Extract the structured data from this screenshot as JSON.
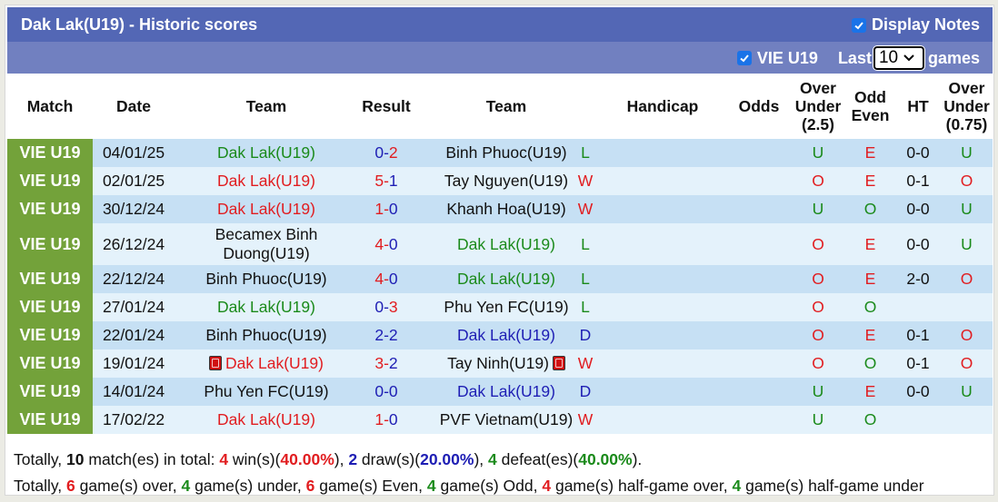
{
  "header": {
    "title": "Dak Lak(U19) - Historic scores",
    "display_notes_label": "Display Notes",
    "display_notes_checked": true
  },
  "filter": {
    "league_label": "VIE U19",
    "league_checked": true,
    "last_label": "Last",
    "games_count": "10",
    "games_label": "games"
  },
  "columns": [
    "Match",
    "Date",
    "Team",
    "Result",
    "Team",
    "Handicap",
    "Odds",
    "Over Under (2.5)",
    "Odd Even",
    "HT",
    "Over Under (0.75)"
  ],
  "columns_multiline": {
    "ou25": [
      "Over",
      "Under",
      "(2.5)"
    ],
    "oddeven": [
      "Odd",
      "Even"
    ],
    "ou075": [
      "Over",
      "Under",
      "(0.75)"
    ]
  },
  "colors": {
    "title_bg": "#5367b5",
    "filter_bg": "#7180c0",
    "match_bg": "#73a23a",
    "row_odd": "#c6e0f4",
    "row_even": "#e4f2fb",
    "red": "#e11d20",
    "blue": "#1e1eb4",
    "green": "#1a8a1a"
  },
  "rows": [
    {
      "match": "VIE U19",
      "date": "04/01/25",
      "home": "Dak Lak(U19)",
      "home_color": "green",
      "home_red_card": false,
      "score_home": "0",
      "score_home_color": "blue",
      "score_away": "2",
      "score_away_color": "red",
      "away": "Binh Phuoc(U19)",
      "away_color": "black",
      "away_red_card": false,
      "wl": "L",
      "wl_color": "green",
      "handicap": "",
      "odds": "",
      "ou25": "U",
      "ou25_color": "green",
      "oe": "E",
      "oe_color": "red",
      "ht": "0-0",
      "ou075": "U",
      "ou075_color": "green"
    },
    {
      "match": "VIE U19",
      "date": "02/01/25",
      "home": "Dak Lak(U19)",
      "home_color": "red",
      "home_red_card": false,
      "score_home": "5",
      "score_home_color": "red",
      "score_away": "1",
      "score_away_color": "blue",
      "away": "Tay Nguyen(U19)",
      "away_color": "black",
      "away_red_card": false,
      "wl": "W",
      "wl_color": "red",
      "handicap": "",
      "odds": "",
      "ou25": "O",
      "ou25_color": "red",
      "oe": "E",
      "oe_color": "red",
      "ht": "0-1",
      "ou075": "O",
      "ou075_color": "red"
    },
    {
      "match": "VIE U19",
      "date": "30/12/24",
      "home": "Dak Lak(U19)",
      "home_color": "red",
      "home_red_card": false,
      "score_home": "1",
      "score_home_color": "red",
      "score_away": "0",
      "score_away_color": "blue",
      "away": "Khanh Hoa(U19)",
      "away_color": "black",
      "away_red_card": false,
      "wl": "W",
      "wl_color": "red",
      "handicap": "",
      "odds": "",
      "ou25": "U",
      "ou25_color": "green",
      "oe": "O",
      "oe_color": "green",
      "ht": "0-0",
      "ou075": "U",
      "ou075_color": "green"
    },
    {
      "match": "VIE U19",
      "date": "26/12/24",
      "home": "Becamex Binh Duong(U19)",
      "home_color": "black",
      "home_red_card": false,
      "score_home": "4",
      "score_home_color": "red",
      "score_away": "0",
      "score_away_color": "blue",
      "away": "Dak Lak(U19)",
      "away_color": "green",
      "away_red_card": false,
      "wl": "L",
      "wl_color": "green",
      "handicap": "",
      "odds": "",
      "ou25": "O",
      "ou25_color": "red",
      "oe": "E",
      "oe_color": "red",
      "ht": "0-0",
      "ou075": "U",
      "ou075_color": "green"
    },
    {
      "match": "VIE U19",
      "date": "22/12/24",
      "home": "Binh Phuoc(U19)",
      "home_color": "black",
      "home_red_card": false,
      "score_home": "4",
      "score_home_color": "red",
      "score_away": "0",
      "score_away_color": "blue",
      "away": "Dak Lak(U19)",
      "away_color": "green",
      "away_red_card": false,
      "wl": "L",
      "wl_color": "green",
      "handicap": "",
      "odds": "",
      "ou25": "O",
      "ou25_color": "red",
      "oe": "E",
      "oe_color": "red",
      "ht": "2-0",
      "ou075": "O",
      "ou075_color": "red"
    },
    {
      "match": "VIE U19",
      "date": "27/01/24",
      "home": "Dak Lak(U19)",
      "home_color": "green",
      "home_red_card": false,
      "score_home": "0",
      "score_home_color": "blue",
      "score_away": "3",
      "score_away_color": "red",
      "away": "Phu Yen FC(U19)",
      "away_color": "black",
      "away_red_card": false,
      "wl": "L",
      "wl_color": "green",
      "handicap": "",
      "odds": "",
      "ou25": "O",
      "ou25_color": "red",
      "oe": "O",
      "oe_color": "green",
      "ht": "",
      "ou075": "",
      "ou075_color": "black"
    },
    {
      "match": "VIE U19",
      "date": "22/01/24",
      "home": "Binh Phuoc(U19)",
      "home_color": "black",
      "home_red_card": false,
      "score_home": "2",
      "score_home_color": "blue",
      "score_away": "2",
      "score_away_color": "blue",
      "away": "Dak Lak(U19)",
      "away_color": "blue",
      "away_red_card": false,
      "wl": "D",
      "wl_color": "blue",
      "handicap": "",
      "odds": "",
      "ou25": "O",
      "ou25_color": "red",
      "oe": "E",
      "oe_color": "red",
      "ht": "0-1",
      "ou075": "O",
      "ou075_color": "red"
    },
    {
      "match": "VIE U19",
      "date": "19/01/24",
      "home": "Dak Lak(U19)",
      "home_color": "red",
      "home_red_card": true,
      "home_red_card_count": "2",
      "score_home": "3",
      "score_home_color": "red",
      "score_away": "2",
      "score_away_color": "blue",
      "away": "Tay Ninh(U19)",
      "away_color": "black",
      "away_red_card": true,
      "away_red_card_count": "1",
      "wl": "W",
      "wl_color": "red",
      "handicap": "",
      "odds": "",
      "ou25": "O",
      "ou25_color": "red",
      "oe": "O",
      "oe_color": "green",
      "ht": "0-1",
      "ou075": "O",
      "ou075_color": "red"
    },
    {
      "match": "VIE U19",
      "date": "14/01/24",
      "home": "Phu Yen FC(U19)",
      "home_color": "black",
      "home_red_card": false,
      "score_home": "0",
      "score_home_color": "blue",
      "score_away": "0",
      "score_away_color": "blue",
      "away": "Dak Lak(U19)",
      "away_color": "blue",
      "away_red_card": false,
      "wl": "D",
      "wl_color": "blue",
      "handicap": "",
      "odds": "",
      "ou25": "U",
      "ou25_color": "green",
      "oe": "E",
      "oe_color": "red",
      "ht": "0-0",
      "ou075": "U",
      "ou075_color": "green"
    },
    {
      "match": "VIE U19",
      "date": "17/02/22",
      "home": "Dak Lak(U19)",
      "home_color": "red",
      "home_red_card": false,
      "score_home": "1",
      "score_home_color": "red",
      "score_away": "0",
      "score_away_color": "blue",
      "away": "PVF Vietnam(U19)",
      "away_color": "black",
      "away_red_card": false,
      "wl": "W",
      "wl_color": "red",
      "handicap": "",
      "odds": "",
      "ou25": "U",
      "ou25_color": "green",
      "oe": "O",
      "oe_color": "green",
      "ht": "",
      "ou075": "",
      "ou075_color": "black"
    }
  ],
  "summary": {
    "line1": [
      {
        "text": "Totally, ",
        "color": "black",
        "bold": false
      },
      {
        "text": "10",
        "color": "black",
        "bold": true
      },
      {
        "text": " match(es) in total: ",
        "color": "black",
        "bold": false
      },
      {
        "text": "4",
        "color": "red",
        "bold": true
      },
      {
        "text": " win(s)(",
        "color": "black",
        "bold": false
      },
      {
        "text": "40.00%",
        "color": "red",
        "bold": true
      },
      {
        "text": "), ",
        "color": "black",
        "bold": false
      },
      {
        "text": "2",
        "color": "blue",
        "bold": true
      },
      {
        "text": " draw(s)(",
        "color": "black",
        "bold": false
      },
      {
        "text": "20.00%",
        "color": "blue",
        "bold": true
      },
      {
        "text": "), ",
        "color": "black",
        "bold": false
      },
      {
        "text": "4",
        "color": "green",
        "bold": true
      },
      {
        "text": " defeat(es)(",
        "color": "black",
        "bold": false
      },
      {
        "text": "40.00%",
        "color": "green",
        "bold": true
      },
      {
        "text": ").",
        "color": "black",
        "bold": false
      }
    ],
    "line2": [
      {
        "text": "Totally, ",
        "color": "black",
        "bold": false
      },
      {
        "text": "6",
        "color": "red",
        "bold": true
      },
      {
        "text": " game(s) over, ",
        "color": "black",
        "bold": false
      },
      {
        "text": "4",
        "color": "green",
        "bold": true
      },
      {
        "text": " game(s) under, ",
        "color": "black",
        "bold": false
      },
      {
        "text": "6",
        "color": "red",
        "bold": true
      },
      {
        "text": " game(s) Even, ",
        "color": "black",
        "bold": false
      },
      {
        "text": "4",
        "color": "green",
        "bold": true
      },
      {
        "text": " game(s) Odd, ",
        "color": "black",
        "bold": false
      },
      {
        "text": "4",
        "color": "red",
        "bold": true
      },
      {
        "text": " game(s) half-game over, ",
        "color": "black",
        "bold": false
      },
      {
        "text": "4",
        "color": "green",
        "bold": true
      },
      {
        "text": " game(s) half-game under",
        "color": "black",
        "bold": false
      }
    ]
  }
}
